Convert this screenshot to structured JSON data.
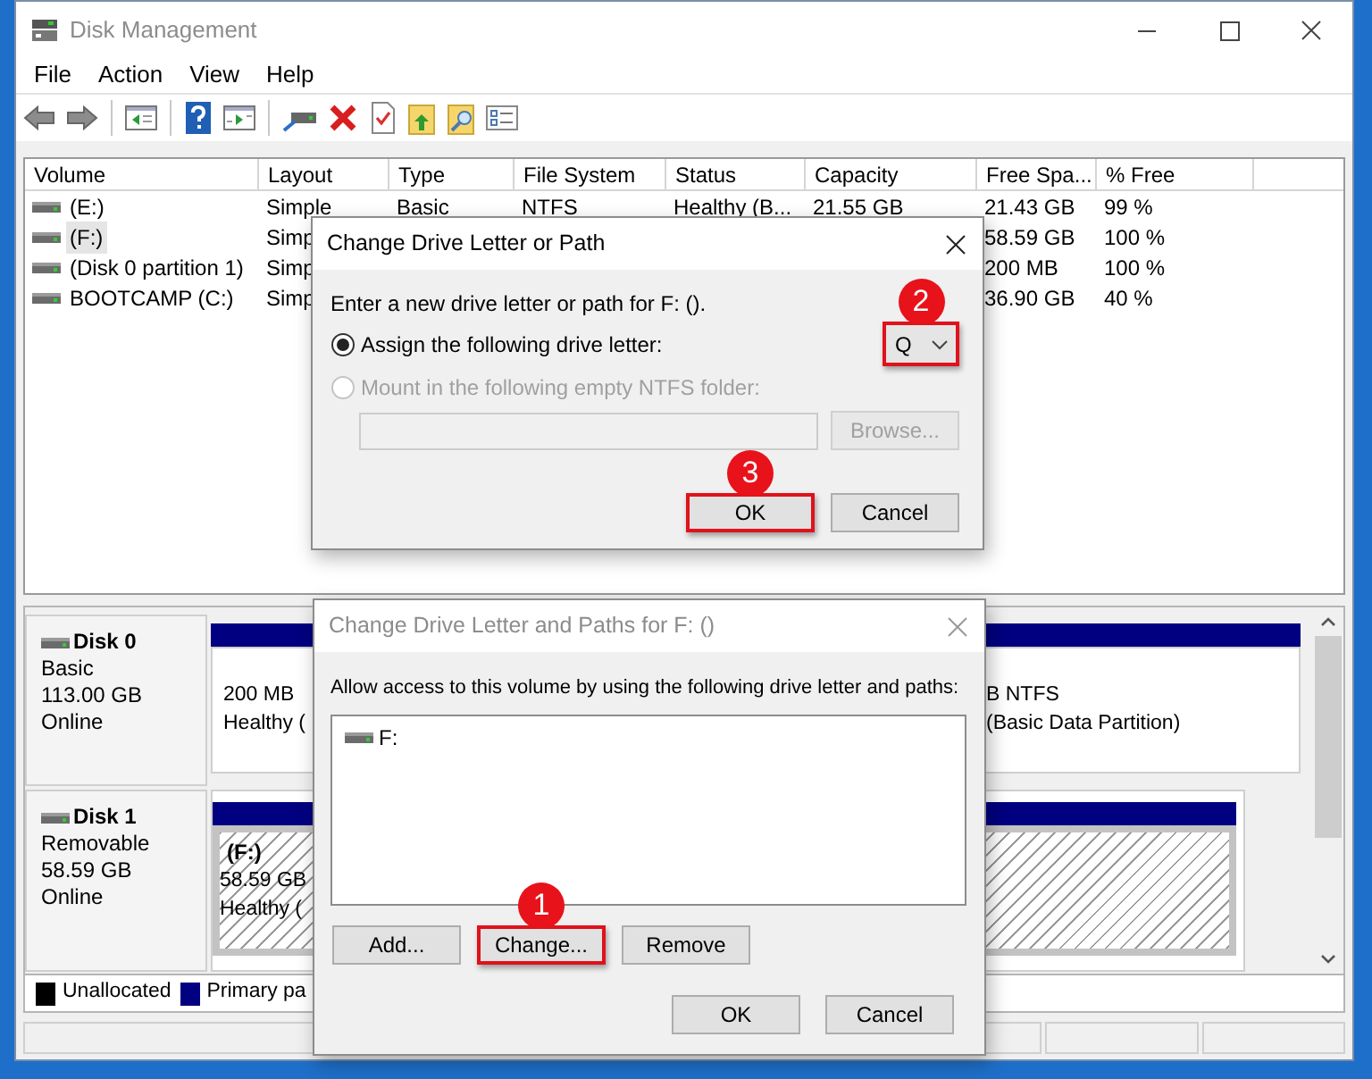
{
  "window": {
    "title": "Disk Management"
  },
  "menu": [
    "File",
    "Action",
    "View",
    "Help"
  ],
  "volume_table": {
    "columns": [
      "Volume",
      "Layout",
      "Type",
      "File System",
      "Status",
      "Capacity",
      "Free Spa...",
      "% Free"
    ],
    "rows": [
      {
        "volume": "(E:)",
        "layout": "Simple",
        "type": "Basic",
        "file_system": "NTFS",
        "status": "Healthy (B...",
        "capacity": "21.55 GB",
        "free_space": "21.43 GB",
        "percent_free": "99 %",
        "selected": false
      },
      {
        "volume": "(F:)",
        "layout": "Simp",
        "free_space": "58.59 GB",
        "percent_free": "100 %",
        "selected": true
      },
      {
        "volume": "(Disk 0 partition 1)",
        "layout": "Simp",
        "free_space": "200 MB",
        "percent_free": "100 %",
        "selected": false
      },
      {
        "volume": "BOOTCAMP (C:)",
        "layout": "Simp",
        "free_space": "36.90 GB",
        "percent_free": "40 %",
        "selected": false
      }
    ]
  },
  "disks": [
    {
      "name": "Disk 0",
      "type": "Basic",
      "size": "113.00 GB",
      "status": "Online",
      "partitions": [
        {
          "lines": [
            "200 MB",
            "Healthy ("
          ],
          "selected": false
        },
        {
          "lines": [
            "B NTFS",
            "(Basic Data Partition)"
          ],
          "selected": false
        }
      ]
    },
    {
      "name": "Disk 1",
      "type": "Removable",
      "size": "58.59 GB",
      "status": "Online",
      "partitions": [
        {
          "label": "(F:)",
          "lines": [
            "58.59 GB",
            "Healthy ("
          ],
          "selected": true
        }
      ]
    }
  ],
  "legend": [
    {
      "label": "Unallocated",
      "color": "#000000"
    },
    {
      "label": "Primary pa",
      "color": "#000080"
    }
  ],
  "dialogs": [
    {
      "kind": "letter",
      "title": "Change Drive Letter or Path",
      "active": true,
      "prompt": "Enter a new drive letter or path for F: ().",
      "options": [
        {
          "label": "Assign the following drive letter:",
          "selected": true,
          "disabled": false
        },
        {
          "label": "Mount in the following empty NTFS folder:",
          "selected": false,
          "disabled": true
        }
      ],
      "drive_letter": {
        "value": "Q",
        "highlighted": true,
        "badge": "2"
      },
      "folder_path": {
        "disabled": true
      },
      "browse_button": {
        "label": "Browse...",
        "disabled": true
      },
      "buttons": [
        {
          "label": "OK",
          "highlighted": true,
          "badge": "3"
        },
        {
          "label": "Cancel",
          "highlighted": false
        }
      ]
    },
    {
      "kind": "paths",
      "title": "Change Drive Letter and Paths for F: ()",
      "active": false,
      "prompt": "Allow access to this volume by using the following drive letter and paths:",
      "paths": [
        {
          "label": "F:",
          "selected": false
        }
      ],
      "actions": [
        {
          "label": "Add...",
          "highlighted": false
        },
        {
          "label": "Change...",
          "highlighted": true,
          "badge": "1"
        },
        {
          "label": "Remove",
          "highlighted": false
        }
      ],
      "buttons": [
        {
          "label": "OK",
          "highlighted": false
        },
        {
          "label": "Cancel",
          "highlighted": false
        }
      ]
    }
  ]
}
